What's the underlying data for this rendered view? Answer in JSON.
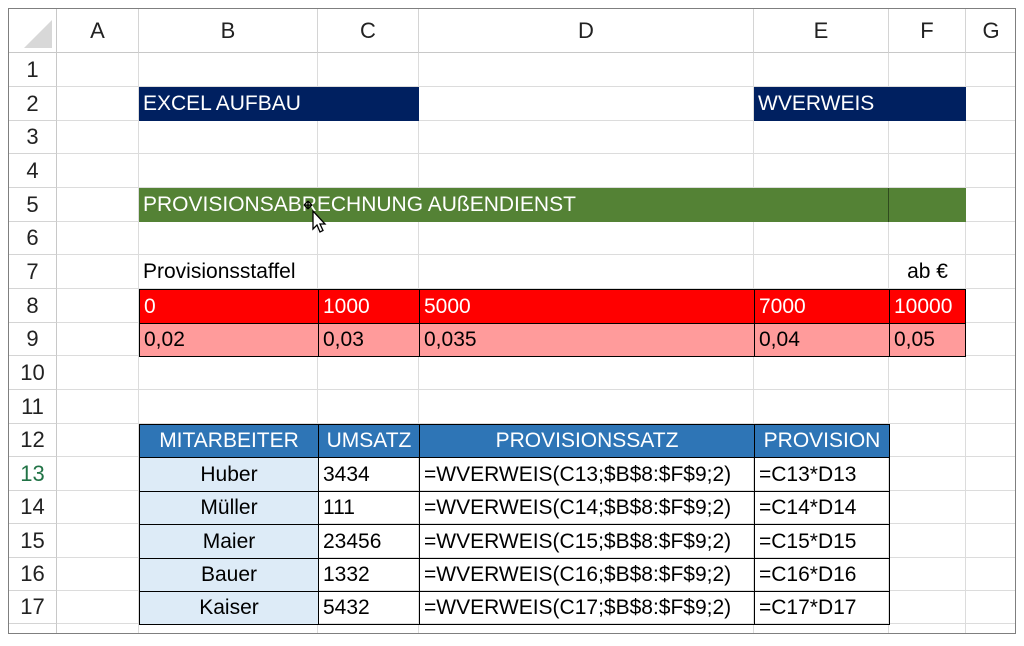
{
  "columns": [
    "A",
    "B",
    "C",
    "D",
    "E",
    "F",
    "G"
  ],
  "rows": [
    "1",
    "2",
    "3",
    "4",
    "5",
    "6",
    "7",
    "8",
    "9",
    "10",
    "11",
    "12",
    "13",
    "14",
    "15",
    "16",
    "17"
  ],
  "active_row": "13",
  "title_left": "EXCEL AUFBAU",
  "title_right": "WVERWEIS",
  "banner": "PROVISIONSABRECHNUNG AUßENDIENST",
  "staffel_label": "Provisionsstaffel",
  "staffel_unit": "ab €",
  "thresholds": [
    "0",
    "1000",
    "5000",
    "7000",
    "10000"
  ],
  "rates": [
    "0,02",
    "0,03",
    "0,035",
    "0,04",
    "0,05"
  ],
  "table": {
    "headers": [
      "MITARBEITER",
      "UMSATZ",
      "PROVISIONSSATZ",
      "PROVISION"
    ],
    "rows": [
      {
        "name": "Huber",
        "umsatz": "3434",
        "satz": "=WVERWEIS(C13;$B$8:$F$9;2)",
        "provision": "=C13*D13"
      },
      {
        "name": "Müller",
        "umsatz": "111",
        "satz": "=WVERWEIS(C14;$B$8:$F$9;2)",
        "provision": "=C14*D14"
      },
      {
        "name": "Maier",
        "umsatz": "23456",
        "satz": "=WVERWEIS(C15;$B$8:$F$9;2)",
        "provision": "=C15*D15"
      },
      {
        "name": "Bauer",
        "umsatz": "1332",
        "satz": "=WVERWEIS(C16;$B$8:$F$9;2)",
        "provision": "=C16*D16"
      },
      {
        "name": "Kaiser",
        "umsatz": "5432",
        "satz": "=WVERWEIS(C17;$B$8:$F$9;2)",
        "provision": "=C17*D17"
      }
    ]
  },
  "colors": {
    "navy": "#002060",
    "green": "#548235",
    "red": "#ff0000",
    "pink": "#ff9b9b",
    "header_blue": "#2e75b6",
    "light_blue": "#ddebf7"
  },
  "icons": {
    "cursor": "move-cursor-icon"
  }
}
